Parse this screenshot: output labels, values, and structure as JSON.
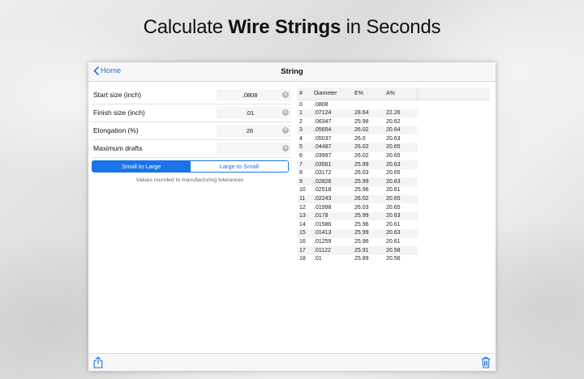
{
  "headline": {
    "prefix": "Calculate ",
    "bold": "Wire Strings",
    "suffix": " in Seconds"
  },
  "navbar": {
    "back_label": "Home",
    "title": "String"
  },
  "form": {
    "rows": [
      {
        "label": "Start size (inch)",
        "value": ".0808"
      },
      {
        "label": "Finish size (inch)",
        "value": ".01"
      },
      {
        "label": "Elongation (%)",
        "value": "26"
      },
      {
        "label": "Maximum drafts",
        "value": ""
      }
    ],
    "segment": {
      "left": "Small to Large",
      "right": "Large to Small",
      "selected": "Small to Large"
    },
    "note": "Values rounded to manufacturing tolerances"
  },
  "table": {
    "headers": [
      "#",
      "Diameter",
      "E%",
      "A%"
    ],
    "rows": [
      [
        "0",
        ".0808",
        "",
        ""
      ],
      [
        "1",
        ".07124",
        "28.64",
        "22.26"
      ],
      [
        "2",
        ".06347",
        "25.98",
        "20.62"
      ],
      [
        "3",
        ".05654",
        "26.02",
        "20.64"
      ],
      [
        "4",
        ".05037",
        "26.0",
        "20.63"
      ],
      [
        "5",
        ".04487",
        "26.02",
        "20.65"
      ],
      [
        "6",
        ".03997",
        "26.02",
        "20.65"
      ],
      [
        "7",
        ".03561",
        "25.99",
        "20.63"
      ],
      [
        "8",
        ".03172",
        "26.03",
        "20.65"
      ],
      [
        "9",
        ".02826",
        "25.99",
        "20.63"
      ],
      [
        "10",
        ".02518",
        "25.96",
        "20.61"
      ],
      [
        "11",
        ".02243",
        "26.02",
        "20.65"
      ],
      [
        "12",
        ".01998",
        "26.03",
        "20.65"
      ],
      [
        "13",
        ".0178",
        "25.99",
        "20.63"
      ],
      [
        "14",
        ".01586",
        "25.96",
        "20.61"
      ],
      [
        "15",
        ".01413",
        "25.99",
        "20.63"
      ],
      [
        "16",
        ".01259",
        "25.96",
        "20.61"
      ],
      [
        "17",
        ".01122",
        "25.91",
        "20.58"
      ],
      [
        "18",
        ".01",
        "25.89",
        "20.56"
      ]
    ]
  },
  "toolbar": {
    "left_icon": "share-icon",
    "right_icon": "trash-icon"
  },
  "colors": {
    "accent": "#1a73e8"
  }
}
